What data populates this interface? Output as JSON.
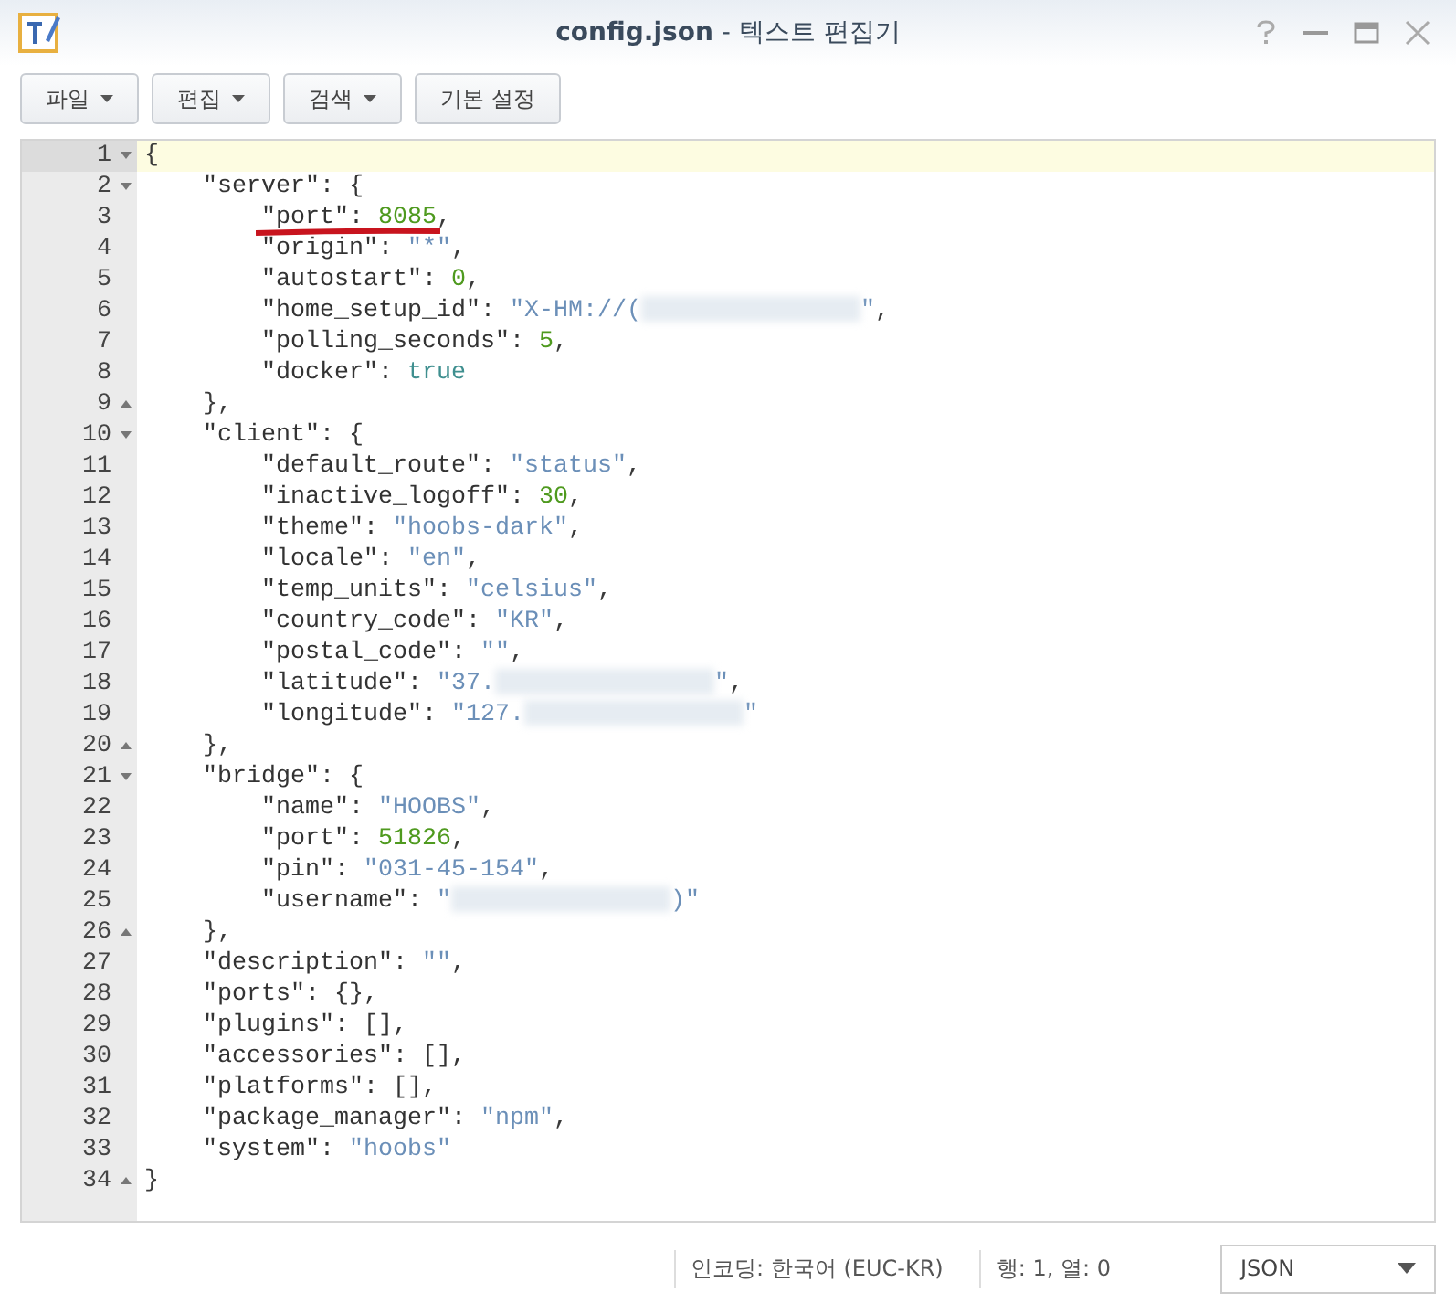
{
  "window": {
    "title": "config.json",
    "subtitle": " - 텍스트 편집기"
  },
  "toolbar": [
    {
      "label": "파일",
      "dropdown": true
    },
    {
      "label": "편집",
      "dropdown": true
    },
    {
      "label": "검색",
      "dropdown": true
    },
    {
      "label": "기본 설정",
      "dropdown": false
    }
  ],
  "editor": {
    "lines": [
      {
        "number": "1",
        "kind": "fold-start",
        "active": true,
        "underlined": false,
        "tokens": [
          {
            "kind": "punct",
            "text": "{"
          }
        ],
        "children": [
          {
            "number": "2",
            "kind": "fold-start",
            "active": false,
            "underlined": false,
            "tokens": [
              {
                "kind": "key",
                "text": "\"server\": {"
              }
            ],
            "children": [
              {
                "number": "3",
                "kind": "plain",
                "active": false,
                "underlined": true,
                "tokens": [
                  {
                    "kind": "key",
                    "text": "\"port\": "
                  },
                  {
                    "kind": "number",
                    "text": "8085"
                  },
                  {
                    "kind": "punct",
                    "text": ","
                  }
                ]
              },
              {
                "number": "4",
                "kind": "plain",
                "active": false,
                "underlined": false,
                "tokens": [
                  {
                    "kind": "key",
                    "text": "\"origin\": "
                  },
                  {
                    "kind": "string",
                    "text": "\"*\""
                  },
                  {
                    "kind": "punct",
                    "text": ","
                  }
                ]
              },
              {
                "number": "5",
                "kind": "plain",
                "active": false,
                "underlined": false,
                "tokens": [
                  {
                    "kind": "key",
                    "text": "\"autostart\": "
                  },
                  {
                    "kind": "number",
                    "text": "0"
                  },
                  {
                    "kind": "punct",
                    "text": ","
                  }
                ]
              },
              {
                "number": "6",
                "kind": "plain",
                "active": false,
                "underlined": false,
                "tokens": [
                  {
                    "kind": "key",
                    "text": "\"home_setup_id\": "
                  },
                  {
                    "kind": "string",
                    "text": "\"X-HM://("
                  },
                  {
                    "kind": "redacted"
                  },
                  {
                    "kind": "string",
                    "text": "\""
                  },
                  {
                    "kind": "punct",
                    "text": ","
                  }
                ]
              },
              {
                "number": "7",
                "kind": "plain",
                "active": false,
                "underlined": false,
                "tokens": [
                  {
                    "kind": "key",
                    "text": "\"polling_seconds\": "
                  },
                  {
                    "kind": "number",
                    "text": "5"
                  },
                  {
                    "kind": "punct",
                    "text": ","
                  }
                ]
              },
              {
                "number": "8",
                "kind": "plain",
                "active": false,
                "underlined": false,
                "tokens": [
                  {
                    "kind": "key",
                    "text": "\"docker\": "
                  },
                  {
                    "kind": "bool",
                    "text": "true"
                  }
                ]
              }
            ]
          },
          {
            "number": "9",
            "kind": "fold-end",
            "active": false,
            "underlined": false,
            "tokens": [
              {
                "kind": "punct",
                "text": "},"
              }
            ]
          },
          {
            "number": "10",
            "kind": "fold-start",
            "active": false,
            "underlined": false,
            "tokens": [
              {
                "kind": "key",
                "text": "\"client\": {"
              }
            ],
            "children": [
              {
                "number": "11",
                "kind": "plain",
                "active": false,
                "underlined": false,
                "tokens": [
                  {
                    "kind": "key",
                    "text": "\"default_route\": "
                  },
                  {
                    "kind": "string",
                    "text": "\"status\""
                  },
                  {
                    "kind": "punct",
                    "text": ","
                  }
                ]
              },
              {
                "number": "12",
                "kind": "plain",
                "active": false,
                "underlined": false,
                "tokens": [
                  {
                    "kind": "key",
                    "text": "\"inactive_logoff\": "
                  },
                  {
                    "kind": "number",
                    "text": "30"
                  },
                  {
                    "kind": "punct",
                    "text": ","
                  }
                ]
              },
              {
                "number": "13",
                "kind": "plain",
                "active": false,
                "underlined": false,
                "tokens": [
                  {
                    "kind": "key",
                    "text": "\"theme\": "
                  },
                  {
                    "kind": "string",
                    "text": "\"hoobs-dark\""
                  },
                  {
                    "kind": "punct",
                    "text": ","
                  }
                ]
              },
              {
                "number": "14",
                "kind": "plain",
                "active": false,
                "underlined": false,
                "tokens": [
                  {
                    "kind": "key",
                    "text": "\"locale\": "
                  },
                  {
                    "kind": "string",
                    "text": "\"en\""
                  },
                  {
                    "kind": "punct",
                    "text": ","
                  }
                ]
              },
              {
                "number": "15",
                "kind": "plain",
                "active": false,
                "underlined": false,
                "tokens": [
                  {
                    "kind": "key",
                    "text": "\"temp_units\": "
                  },
                  {
                    "kind": "string",
                    "text": "\"celsius\""
                  },
                  {
                    "kind": "punct",
                    "text": ","
                  }
                ]
              },
              {
                "number": "16",
                "kind": "plain",
                "active": false,
                "underlined": false,
                "tokens": [
                  {
                    "kind": "key",
                    "text": "\"country_code\": "
                  },
                  {
                    "kind": "string",
                    "text": "\"KR\""
                  },
                  {
                    "kind": "punct",
                    "text": ","
                  }
                ]
              },
              {
                "number": "17",
                "kind": "plain",
                "active": false,
                "underlined": false,
                "tokens": [
                  {
                    "kind": "key",
                    "text": "\"postal_code\": "
                  },
                  {
                    "kind": "string",
                    "text": "\"\""
                  },
                  {
                    "kind": "punct",
                    "text": ","
                  }
                ]
              },
              {
                "number": "18",
                "kind": "plain",
                "active": false,
                "underlined": false,
                "tokens": [
                  {
                    "kind": "key",
                    "text": "\"latitude\": "
                  },
                  {
                    "kind": "string",
                    "text": "\"37."
                  },
                  {
                    "kind": "redacted"
                  },
                  {
                    "kind": "string",
                    "text": "\""
                  },
                  {
                    "kind": "punct",
                    "text": ","
                  }
                ]
              },
              {
                "number": "19",
                "kind": "plain",
                "active": false,
                "underlined": false,
                "tokens": [
                  {
                    "kind": "key",
                    "text": "\"longitude\": "
                  },
                  {
                    "kind": "string",
                    "text": "\"127."
                  },
                  {
                    "kind": "redacted"
                  },
                  {
                    "kind": "string",
                    "text": "\""
                  }
                ]
              }
            ]
          },
          {
            "number": "20",
            "kind": "fold-end",
            "active": false,
            "underlined": false,
            "tokens": [
              {
                "kind": "punct",
                "text": "},"
              }
            ]
          },
          {
            "number": "21",
            "kind": "fold-start",
            "active": false,
            "underlined": false,
            "tokens": [
              {
                "kind": "key",
                "text": "\"bridge\": {"
              }
            ],
            "children": [
              {
                "number": "22",
                "kind": "plain",
                "active": false,
                "underlined": false,
                "tokens": [
                  {
                    "kind": "key",
                    "text": "\"name\": "
                  },
                  {
                    "kind": "string",
                    "text": "\"HOOBS\""
                  },
                  {
                    "kind": "punct",
                    "text": ","
                  }
                ]
              },
              {
                "number": "23",
                "kind": "plain",
                "active": false,
                "underlined": false,
                "tokens": [
                  {
                    "kind": "key",
                    "text": "\"port\": "
                  },
                  {
                    "kind": "number",
                    "text": "51826"
                  },
                  {
                    "kind": "punct",
                    "text": ","
                  }
                ]
              },
              {
                "number": "24",
                "kind": "plain",
                "active": false,
                "underlined": false,
                "tokens": [
                  {
                    "kind": "key",
                    "text": "\"pin\": "
                  },
                  {
                    "kind": "string",
                    "text": "\"031-45-154\""
                  },
                  {
                    "kind": "punct",
                    "text": ","
                  }
                ]
              },
              {
                "number": "25",
                "kind": "plain",
                "active": false,
                "underlined": false,
                "tokens": [
                  {
                    "kind": "key",
                    "text": "\"username\": "
                  },
                  {
                    "kind": "string",
                    "text": "\""
                  },
                  {
                    "kind": "redacted"
                  },
                  {
                    "kind": "string",
                    "text": ")\""
                  }
                ]
              }
            ]
          },
          {
            "number": "26",
            "kind": "fold-end",
            "active": false,
            "underlined": false,
            "tokens": [
              {
                "kind": "punct",
                "text": "},"
              }
            ]
          },
          {
            "number": "27",
            "kind": "plain",
            "active": false,
            "underlined": false,
            "tokens": [
              {
                "kind": "key",
                "text": "\"description\": "
              },
              {
                "kind": "string",
                "text": "\"\""
              },
              {
                "kind": "punct",
                "text": ","
              }
            ]
          },
          {
            "number": "28",
            "kind": "plain",
            "active": false,
            "underlined": false,
            "tokens": [
              {
                "kind": "key",
                "text": "\"ports\": {},"
              }
            ]
          },
          {
            "number": "29",
            "kind": "plain",
            "active": false,
            "underlined": false,
            "tokens": [
              {
                "kind": "key",
                "text": "\"plugins\": [],"
              }
            ]
          },
          {
            "number": "30",
            "kind": "plain",
            "active": false,
            "underlined": false,
            "tokens": [
              {
                "kind": "key",
                "text": "\"accessories\": [],"
              }
            ]
          },
          {
            "number": "31",
            "kind": "plain",
            "active": false,
            "underlined": false,
            "tokens": [
              {
                "kind": "key",
                "text": "\"platforms\": [],"
              }
            ]
          },
          {
            "number": "32",
            "kind": "plain",
            "active": false,
            "underlined": false,
            "tokens": [
              {
                "kind": "key",
                "text": "\"package_manager\": "
              },
              {
                "kind": "string",
                "text": "\"npm\""
              },
              {
                "kind": "punct",
                "text": ","
              }
            ]
          },
          {
            "number": "33",
            "kind": "plain",
            "active": false,
            "underlined": false,
            "tokens": [
              {
                "kind": "key",
                "text": "\"system\": "
              },
              {
                "kind": "string",
                "text": "\"hoobs\""
              }
            ]
          }
        ]
      },
      {
        "number": "34",
        "kind": "fold-end",
        "active": false,
        "underlined": false,
        "tokens": [
          {
            "kind": "punct",
            "text": "}"
          }
        ]
      }
    ]
  },
  "status_bar": {
    "encoding": "인코딩: 한국어 (EUC-KR)",
    "position": "행: 1, 열: 0",
    "language": "JSON"
  }
}
